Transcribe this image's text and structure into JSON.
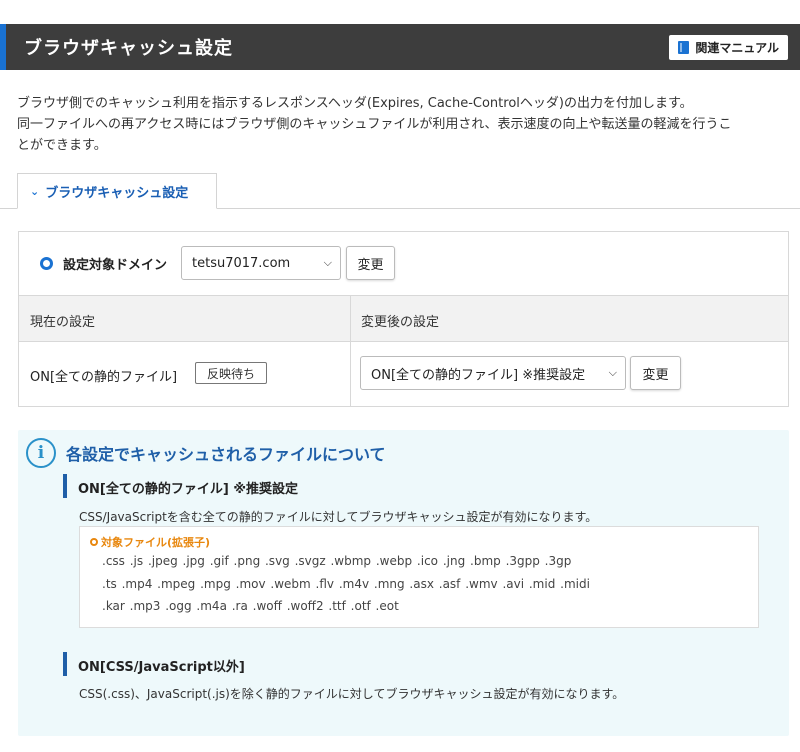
{
  "header": {
    "title": "ブラウザキャッシュ設定",
    "manual_button": "関連マニュアル"
  },
  "intro": {
    "line1": "ブラウザ側でのキャッシュ利用を指示するレスポンスヘッダ(Expires, Cache-Controlヘッダ)の出力を付加します。",
    "line2": "同一ファイルへの再アクセス時にはブラウザ側のキャッシュファイルが利用され、表示速度の向上や転送量の軽減を行うこ",
    "line3": "とができます。"
  },
  "tab": {
    "label": "ブラウザキャッシュ設定"
  },
  "domain_row": {
    "label": "設定対象ドメイン",
    "selected_domain": "tetsu7017.com",
    "change_button": "変更"
  },
  "table": {
    "headers": [
      "現在の設定",
      "変更後の設定"
    ],
    "current_value": "ON[全ての静的ファイル]",
    "status_badge": "反映待ち",
    "new_value": "ON[全ての静的ファイル] ※推奨設定",
    "change_button": "変更"
  },
  "info": {
    "title": "各設定でキャッシュされるファイルについて",
    "sections": [
      {
        "title": "ON[全ての静的ファイル] ※推奨設定",
        "desc": "CSS/JavaScriptを含む全ての静的ファイルに対してブラウザキャッシュ設定が有効になります。",
        "ext_label": "対象ファイル(拡張子)",
        "ext_lines": [
          ".css .js .jpeg .jpg .gif .png .svg .svgz .wbmp .webp .ico .jng .bmp .3gpp .3gp",
          ".ts .mp4 .mpeg .mpg .mov .webm .flv .m4v .mng .asx .asf .wmv .avi .mid .midi",
          ".kar .mp3 .ogg .m4a .ra .woff .woff2 .ttf .otf .eot"
        ]
      },
      {
        "title": "ON[CSS/JavaScript以外]",
        "desc": "CSS(.css)、JavaScript(.js)を除く静的ファイルに対してブラウザキャッシュ設定が有効になります。"
      }
    ]
  },
  "colors": {
    "accent": "#1a72d2",
    "header_bg": "#3d3d3d",
    "info_bg": "#eef9fb",
    "ext_label": "#e8870e"
  }
}
